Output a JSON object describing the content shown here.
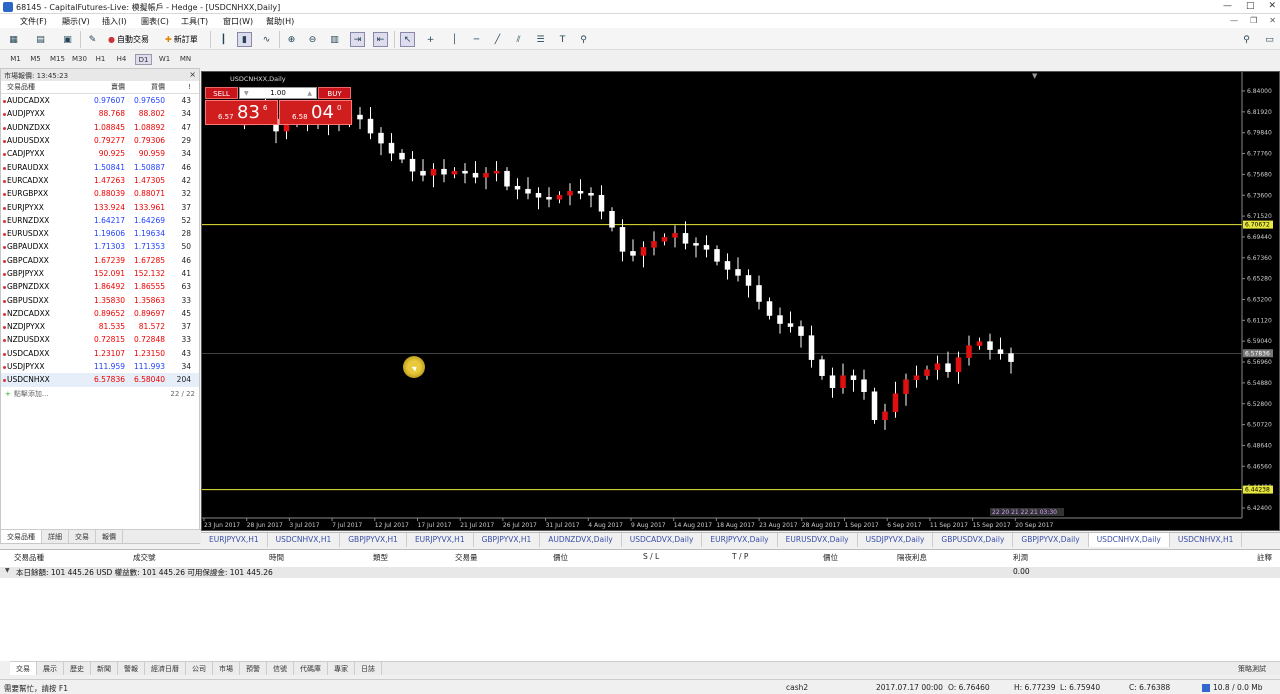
{
  "window": {
    "title": "68145 - CapitalFutures-Live: 模擬帳戶 - Hedge - [USDCNHXX,Daily]",
    "minimize": "—",
    "maximize": "□",
    "close": "✕"
  },
  "menu": [
    "文件(F)",
    "顯示(V)",
    "插入(I)",
    "圖表(C)",
    "工具(T)",
    "窗口(W)",
    "幫助(H)"
  ],
  "mdi": {
    "minimize": "—",
    "restore": "❐",
    "close": "✕"
  },
  "toolbar": {
    "auto_trading": "自動交易",
    "new_order": "新訂單"
  },
  "timeframes": [
    "M1",
    "M5",
    "M15",
    "M30",
    "H1",
    "H4",
    "D1",
    "W1",
    "MN"
  ],
  "timeframe_active": "D1",
  "market_watch": {
    "title": "市場報價: 13:45:23",
    "close": "×",
    "headers": [
      "交易品種",
      "賣價",
      "買價",
      "!"
    ],
    "rows": [
      {
        "symbol": "AUDCADXX",
        "bid": "0.97607",
        "ask": "0.97650",
        "spread": "43",
        "dir": "up"
      },
      {
        "symbol": "AUDJPYXX",
        "bid": "88.768",
        "ask": "88.802",
        "spread": "34",
        "dir": "dn"
      },
      {
        "symbol": "AUDNZDXX",
        "bid": "1.08845",
        "ask": "1.08892",
        "spread": "47",
        "dir": "dn"
      },
      {
        "symbol": "AUDUSDXX",
        "bid": "0.79277",
        "ask": "0.79306",
        "spread": "29",
        "dir": "dn"
      },
      {
        "symbol": "CADJPYXX",
        "bid": "90.925",
        "ask": "90.959",
        "spread": "34",
        "dir": "dn"
      },
      {
        "symbol": "EURAUDXX",
        "bid": "1.50841",
        "ask": "1.50887",
        "spread": "46",
        "dir": "up"
      },
      {
        "symbol": "EURCADXX",
        "bid": "1.47263",
        "ask": "1.47305",
        "spread": "42",
        "dir": "dn"
      },
      {
        "symbol": "EURGBPXX",
        "bid": "0.88039",
        "ask": "0.88071",
        "spread": "32",
        "dir": "dn"
      },
      {
        "symbol": "EURJPYXX",
        "bid": "133.924",
        "ask": "133.961",
        "spread": "37",
        "dir": "dn"
      },
      {
        "symbol": "EURNZDXX",
        "bid": "1.64217",
        "ask": "1.64269",
        "spread": "52",
        "dir": "up"
      },
      {
        "symbol": "EURUSDXX",
        "bid": "1.19606",
        "ask": "1.19634",
        "spread": "28",
        "dir": "up"
      },
      {
        "symbol": "GBPAUDXX",
        "bid": "1.71303",
        "ask": "1.71353",
        "spread": "50",
        "dir": "up"
      },
      {
        "symbol": "GBPCADXX",
        "bid": "1.67239",
        "ask": "1.67285",
        "spread": "46",
        "dir": "dn"
      },
      {
        "symbol": "GBPJPYXX",
        "bid": "152.091",
        "ask": "152.132",
        "spread": "41",
        "dir": "dn"
      },
      {
        "symbol": "GBPNZDXX",
        "bid": "1.86492",
        "ask": "1.86555",
        "spread": "63",
        "dir": "dn"
      },
      {
        "symbol": "GBPUSDXX",
        "bid": "1.35830",
        "ask": "1.35863",
        "spread": "33",
        "dir": "dn"
      },
      {
        "symbol": "NZDCADXX",
        "bid": "0.89652",
        "ask": "0.89697",
        "spread": "45",
        "dir": "dn"
      },
      {
        "symbol": "NZDJPYXX",
        "bid": "81.535",
        "ask": "81.572",
        "spread": "37",
        "dir": "dn"
      },
      {
        "symbol": "NZDUSDXX",
        "bid": "0.72815",
        "ask": "0.72848",
        "spread": "33",
        "dir": "dn"
      },
      {
        "symbol": "USDCADXX",
        "bid": "1.23107",
        "ask": "1.23150",
        "spread": "43",
        "dir": "dn"
      },
      {
        "symbol": "USDJPYXX",
        "bid": "111.959",
        "ask": "111.993",
        "spread": "34",
        "dir": "up"
      },
      {
        "symbol": "USDCNHXX",
        "bid": "6.57836",
        "ask": "6.58040",
        "spread": "204",
        "dir": "dn"
      }
    ],
    "add_label": "點擊添加...",
    "count": "22 / 22",
    "tabs": [
      "交易品種",
      "詳細",
      "交易",
      "報價"
    ]
  },
  "chart": {
    "title": "USDCNHXX,Daily",
    "one_click": {
      "sell": "SELL",
      "buy": "BUY",
      "volume": "1.00",
      "sell_small": "6.57",
      "sell_big": "83",
      "sell_sup": "6",
      "buy_small": "6.58",
      "buy_big": "04",
      "buy_sup": "0",
      "down": "▼",
      "up": "▲"
    },
    "yaxis_labels": [
      "6.84000",
      "6.81920",
      "6.79840",
      "6.77760",
      "6.75680",
      "6.73600",
      "6.71520",
      "6.69440",
      "6.67360",
      "6.65280",
      "6.63200",
      "6.61120",
      "6.59040",
      "6.56960",
      "6.54880",
      "6.52800",
      "6.50720",
      "6.48640",
      "6.46560",
      "6.44480",
      "6.42400"
    ],
    "hline_upper": "6.70672",
    "hline_lower": "6.44238",
    "bid_label": "6.57836",
    "xaxis_labels": [
      "23 Jun 2017",
      "28 Jun 2017",
      "3 Jul 2017",
      "7 Jul 2017",
      "12 Jul 2017",
      "17 Jul 2017",
      "21 Jul 2017",
      "26 Jul 2017",
      "31 Jul 2017",
      "4 Aug 2017",
      "9 Aug 2017",
      "14 Aug 2017",
      "18 Aug 2017",
      "23 Aug 2017",
      "28 Aug 2017",
      "1 Sep 2017",
      "6 Sep 2017",
      "11 Sep 2017",
      "15 Sep 2017",
      "20 Sep 2017"
    ],
    "clock_label": "22 20 21 22 21 03:30"
  },
  "chart_tabs": [
    "EURJPYVX,H1",
    "USDCNHVX,H1",
    "GBPJPYVX,H1",
    "EURJPYVX,H1",
    "GBPJPYVX,H1",
    "AUDNZDVX,Daily",
    "USDCADVX,Daily",
    "EURJPYVX,Daily",
    "EURUSDVX,Daily",
    "USDJPYVX,Daily",
    "GBPUSDVX,Daily",
    "GBPJPYVX,Daily",
    "USDCNHVX,Daily",
    "USDCNHVX,H1"
  ],
  "chart_tab_active": 12,
  "terminal": {
    "headers": [
      "交易品種",
      "成交號",
      "時間",
      "類型",
      "交易量",
      "價位",
      "S / L",
      "T / P",
      "價位",
      "隔夜利息",
      "利潤",
      "註釋"
    ],
    "balance_line": "本日餘額: 101 445.26 USD  權益數: 101 445.26  可用保證金: 101 445.26",
    "profit": "0.00",
    "tabs": [
      "交易",
      "展示",
      "歷史",
      "新聞",
      "警報",
      "經濟日曆",
      "公司",
      "市場",
      "預警",
      "信號",
      "代碼庫",
      "專家",
      "日誌"
    ],
    "right_label": "策略測試"
  },
  "status": {
    "help": "需要幫忙，請按 F1",
    "profile": "cash2",
    "datetime": "2017.07.17 00:00",
    "open": "O: 6.76460",
    "high": "H: 6.77239",
    "low": "L: 6.75940",
    "close": "C: 6.76388",
    "traffic": "10.8 / 0.0 Mb"
  }
}
